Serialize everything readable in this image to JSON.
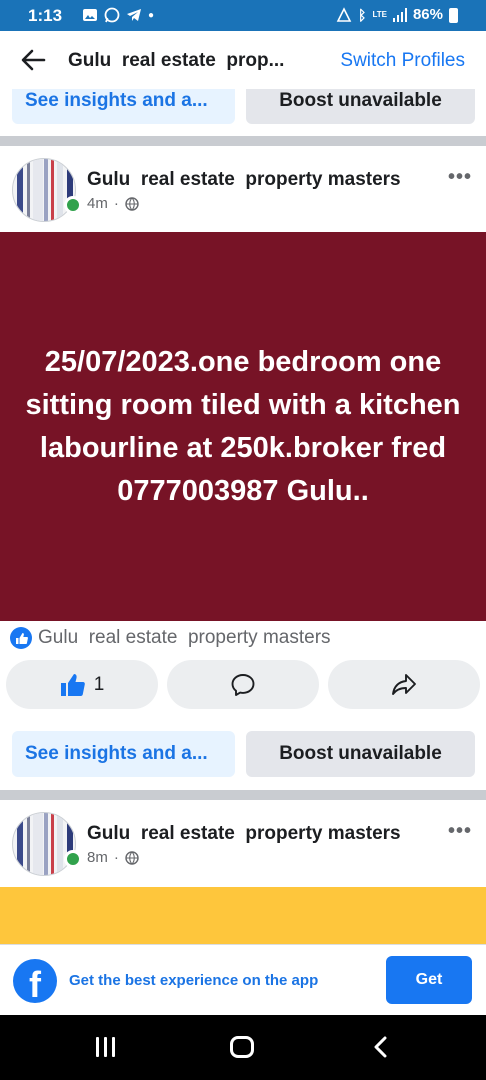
{
  "status_bar": {
    "time": "1:13",
    "battery": "86%",
    "network": "LTE"
  },
  "header": {
    "title": "Gulu  real estate  prop...",
    "switch_profiles": "Switch Profiles"
  },
  "top_actions": {
    "insights": "See insights and a...",
    "boost": "Boost unavailable"
  },
  "post1": {
    "author": "Gulu  real estate  property masters",
    "time": "4m",
    "text": "25/07/2023.one bedroom one sitting room tiled with a kitchen labourline at 250k.broker fred 0777003987 Gulu..",
    "background": "#771326",
    "liked_by": "Gulu  real estate  property masters",
    "like_count": "1",
    "insights": "See insights and a...",
    "boost": "Boost unavailable"
  },
  "post2": {
    "author": "Gulu  real estate  property masters",
    "time": "8m",
    "background": "#fec63c"
  },
  "app_promo": {
    "text": "Get the best experience on the app",
    "button": "Get"
  },
  "colors": {
    "accent": "#1877f2",
    "status_bar": "#1a73b8"
  }
}
